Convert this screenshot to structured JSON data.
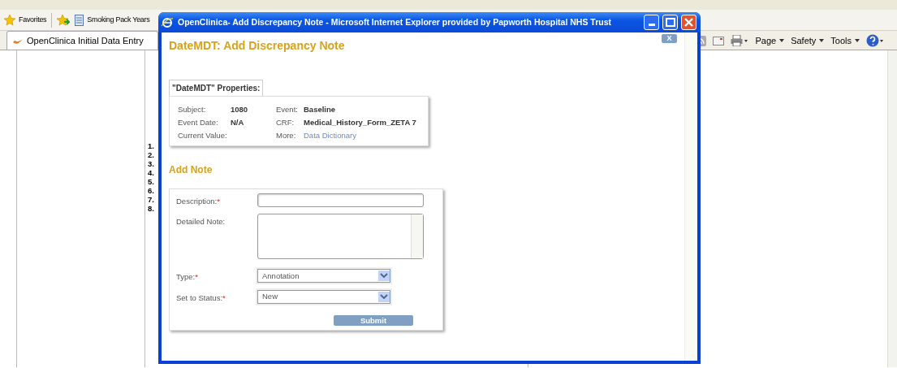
{
  "browser": {
    "favorites_bar": {
      "favorites": "Favorites",
      "links": [
        "Smoking Pack Years"
      ]
    },
    "tabs": [
      {
        "label": "OpenClinica Initial Data Entry",
        "selected": true
      }
    ],
    "toolbar": [
      "Page",
      "Safety",
      "Tools"
    ],
    "page": {
      "list_numbers": [
        "1.",
        "2.",
        "3.",
        "4.",
        "5.",
        "6.",
        "7.",
        "8."
      ]
    }
  },
  "popup": {
    "title": "OpenClinica- Add Discrepancy Note - Microsoft Internet Explorer provided by Papworth Hospital NHS Trust",
    "close_label": "X",
    "heading": "DateMDT: Add Discrepancy Note",
    "properties": {
      "tab": "\"DateMDT\" Properties:",
      "rows": [
        {
          "label": "Subject:",
          "value": "1080",
          "label_2": "Event:",
          "value_2": "Baseline"
        },
        {
          "label": "Event Date:",
          "value": "N/A",
          "label_2": "CRF:",
          "value_2": "Medical_History_Form_ZETA 7"
        },
        {
          "label": "Current Value:",
          "label_2": "More:",
          "link": "Data Dictionary"
        }
      ]
    },
    "add_note": {
      "heading": "Add Note",
      "fields": [
        {
          "kind": "input",
          "label": "Description:",
          "marker": "*"
        },
        {
          "kind": "textarea",
          "label": "Detailed Note:"
        },
        {
          "kind": "select",
          "label": "Type:",
          "marker": "*",
          "value": "Annotation"
        },
        {
          "kind": "select",
          "label": "Set to Status:",
          "marker": "*",
          "value": "New"
        }
      ],
      "submit": "Submit"
    }
  }
}
